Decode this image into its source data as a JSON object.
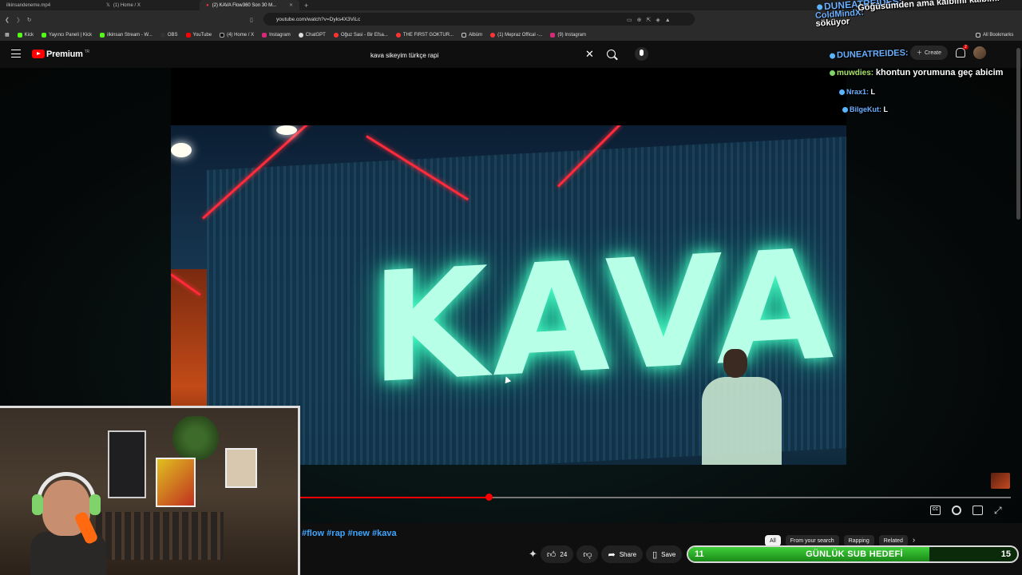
{
  "browser": {
    "tabs": [
      {
        "label": "ilkinsandeneme.mp4",
        "active": false
      },
      {
        "label": "(1) Home / X",
        "active": false
      },
      {
        "label": "(2) KAVA Flow360 Son 30 M...",
        "active": true
      }
    ],
    "new_tab": "+",
    "url": "youtube.com/watch?v=Dyks4X3ViLc",
    "bookmarks": [
      "Kick",
      "Yayıncı Paneli | Kick",
      "ilkinsan Stream - W...",
      "OBS",
      "YouTube",
      "(4) Home / X",
      "Instagram",
      "ChatGPT",
      "Oğuz Sasi - Bir Efsa...",
      "THE FIRST GOKTUR...",
      "Albüm",
      "(1) Mepraz Offical -...",
      "(9) Instagram"
    ],
    "all_bookmarks": "All Bookmarks"
  },
  "youtube": {
    "logo_text": "Premium",
    "region": "TR",
    "search_value": "kava sikeyim türkçe rapi",
    "create_label": "Create",
    "notification_count": "2"
  },
  "video": {
    "screen_text": "KAVA",
    "progress": 0.265,
    "hashtags": "#flow #rap #new #kava",
    "like_count": "24",
    "share_label": "Share",
    "save_label": "Save",
    "cc_label": "CC"
  },
  "chips": {
    "items": [
      "All",
      "From your search",
      "Rapping",
      "Related"
    ],
    "active": "All"
  },
  "chat": {
    "messages": [
      {
        "user": "DUNEATREIDES:",
        "text": ""
      },
      {
        "user": "ColdMindX:",
        "text": "Göğüsümden ama kalbimi kalbimi söküyor"
      },
      {
        "user": "DUNEATREIDES:",
        "text": ""
      },
      {
        "user": "muwdies:",
        "text": "khontun yorumuna geç abicim"
      },
      {
        "user": "Nrax1:",
        "text": "L"
      },
      {
        "user": "BilgeKut:",
        "text": "L"
      }
    ]
  },
  "subgoal": {
    "title": "GÜNLÜK SUB HEDEFİ",
    "current": "11",
    "target": "15",
    "fraction": 0.733
  }
}
